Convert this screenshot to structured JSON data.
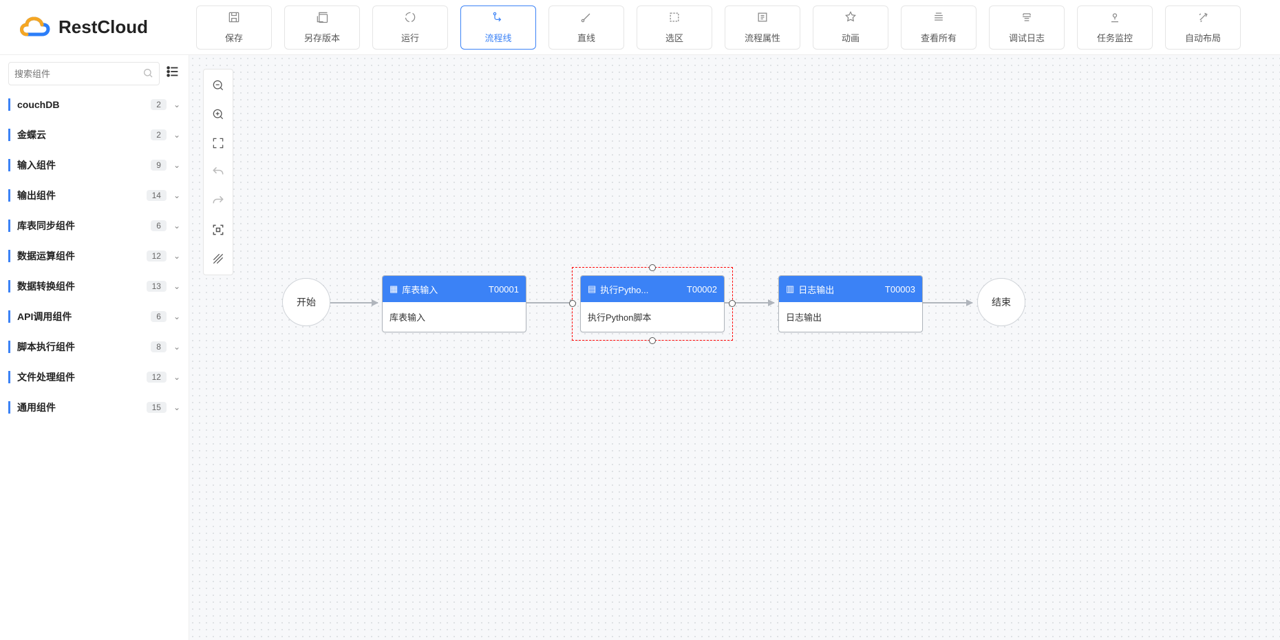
{
  "logo": "RestCloud",
  "toolbar": [
    {
      "label": "保存",
      "active": false
    },
    {
      "label": "另存版本",
      "active": false
    },
    {
      "label": "运行",
      "active": false
    },
    {
      "label": "流程线",
      "active": true
    },
    {
      "label": "直线",
      "active": false
    },
    {
      "label": "选区",
      "active": false
    },
    {
      "label": "流程属性",
      "active": false
    },
    {
      "label": "动画",
      "active": false
    },
    {
      "label": "查看所有",
      "active": false
    },
    {
      "label": "调试日志",
      "active": false
    },
    {
      "label": "任务监控",
      "active": false
    },
    {
      "label": "自动布局",
      "active": false
    }
  ],
  "sidebar": {
    "search_placeholder": "搜索组件",
    "items": [
      {
        "label": "couchDB",
        "count": "2"
      },
      {
        "label": "金蝶云",
        "count": "2"
      },
      {
        "label": "输入组件",
        "count": "9"
      },
      {
        "label": "输出组件",
        "count": "14"
      },
      {
        "label": "库表同步组件",
        "count": "6"
      },
      {
        "label": "数据运算组件",
        "count": "12"
      },
      {
        "label": "数据转换组件",
        "count": "13"
      },
      {
        "label": "API调用组件",
        "count": "6"
      },
      {
        "label": "脚本执行组件",
        "count": "8"
      },
      {
        "label": "文件处理组件",
        "count": "12"
      },
      {
        "label": "通用组件",
        "count": "15"
      }
    ]
  },
  "flow": {
    "start": "开始",
    "end": "结束",
    "nodes": [
      {
        "title": "库表输入",
        "code": "T00001",
        "body": "库表输入",
        "selected": false
      },
      {
        "title": "执行Pytho...",
        "code": "T00002",
        "body": "执行Python脚本",
        "selected": true
      },
      {
        "title": "日志输出",
        "code": "T00003",
        "body": "日志输出",
        "selected": false
      }
    ]
  }
}
